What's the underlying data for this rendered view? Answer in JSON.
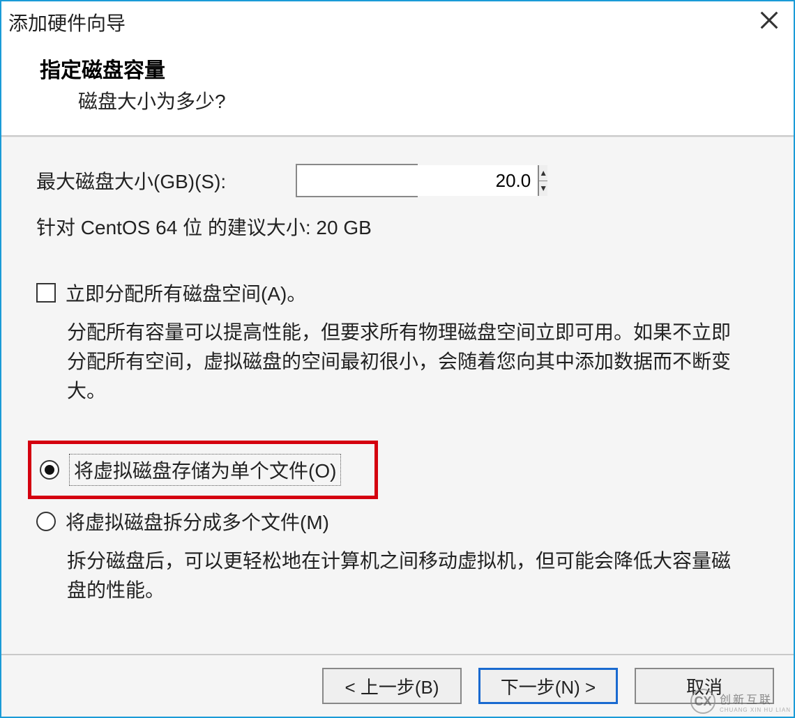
{
  "window": {
    "title": "添加硬件向导"
  },
  "header": {
    "title": "指定磁盘容量",
    "subtitle": "磁盘大小为多少?"
  },
  "disk": {
    "size_label": "最大磁盘大小(GB)(S):",
    "size_value": "20.0",
    "recommend": "针对 CentOS 64 位 的建议大小: 20 GB"
  },
  "allocate": {
    "label": "立即分配所有磁盘空间(A)。",
    "desc": "分配所有容量可以提高性能，但要求所有物理磁盘空间立即可用。如果不立即分配所有空间，虚拟磁盘的空间最初很小，会随着您向其中添加数据而不断变大。"
  },
  "storage": {
    "single_label": "将虚拟磁盘存储为单个文件(O)",
    "split_label": "将虚拟磁盘拆分成多个文件(M)",
    "split_desc": "拆分磁盘后，可以更轻松地在计算机之间移动虚拟机，但可能会降低大容量磁盘的性能。"
  },
  "footer": {
    "back": "< 上一步(B)",
    "next": "下一步(N) >",
    "cancel": "取消"
  },
  "watermark": {
    "brand": "创新互联",
    "sub": "CHUANG XIN HU LIAN"
  }
}
